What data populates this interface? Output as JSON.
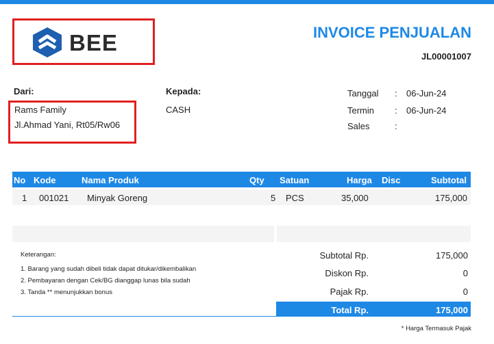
{
  "brand": {
    "name": "BEE",
    "accent": "#1e88e5"
  },
  "invoice": {
    "title": "INVOICE PENJUALAN",
    "number": "JL00001007"
  },
  "from": {
    "label": "Dari:",
    "name": "Rams Family",
    "address": "Jl.Ahmad Yani, Rt05/Rw06"
  },
  "to": {
    "label": "Kepada:",
    "name": "CASH"
  },
  "meta": {
    "date_label": "Tanggal",
    "date_value": "06-Jun-24",
    "term_label": "Termin",
    "term_value": "06-Jun-24",
    "sales_label": "Sales",
    "sales_value": "",
    "sep": ":"
  },
  "table": {
    "headers": {
      "no": "No",
      "code": "Kode",
      "product": "Nama Produk",
      "qty": "Qty",
      "unit": "Satuan",
      "price": "Harga",
      "disc": "Disc",
      "subtotal": "Subtotal"
    },
    "rows": [
      {
        "no": "1",
        "code": "001021",
        "product": "Minyak Goreng",
        "qty": "5",
        "unit": "PCS",
        "price": "35,000",
        "disc": "",
        "subtotal": "175,000"
      }
    ]
  },
  "notes": {
    "title": "Keterangan:",
    "lines": [
      "1. Barang yang sudah dibeli tidak dapat ditukar/dikembalikan",
      "2. Pembayaran dengan Cek/BG dianggap lunas bila sudah",
      "3. Tanda ** menunjukkan bonus"
    ]
  },
  "summary": {
    "subtotal_label": "Subtotal Rp.",
    "subtotal_value": "175,000",
    "discount_label": "Diskon Rp.",
    "discount_value": "0",
    "tax_label": "Pajak Rp.",
    "tax_value": "0",
    "total_label": "Total Rp.",
    "total_value": "175,000"
  },
  "footer_note": "* Harga Termasuk Pajak"
}
